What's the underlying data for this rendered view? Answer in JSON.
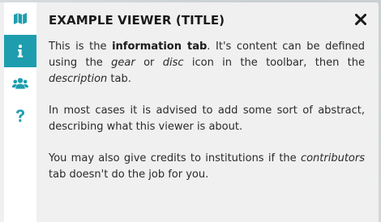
{
  "window": {
    "title": "EXAMPLE VIEWER (TITLE)"
  },
  "toolbar": {
    "items": [
      {
        "icon": "map-icon",
        "active": false
      },
      {
        "icon": "info-icon",
        "active": true
      },
      {
        "icon": "contributors-icon",
        "active": false
      },
      {
        "icon": "help-icon",
        "active": false
      }
    ],
    "accent_color": "#1d9dae",
    "icon_color": "#1d9dae"
  },
  "content": {
    "p1": {
      "a": "This is the ",
      "b": "information tab",
      "c": ". It's content can be defined using the ",
      "d": "gear",
      "e": " or ",
      "f": "disc",
      "g": " icon in the toolbar, then the ",
      "h": "description",
      "i": " tab."
    },
    "p2": "In most cases it is advised to add some sort of abstract, describing what this viewer is about.",
    "p3": {
      "a": "You may also give credits to institutions if the ",
      "b": "contributors",
      "c": " tab doesn't do the job for you."
    }
  }
}
